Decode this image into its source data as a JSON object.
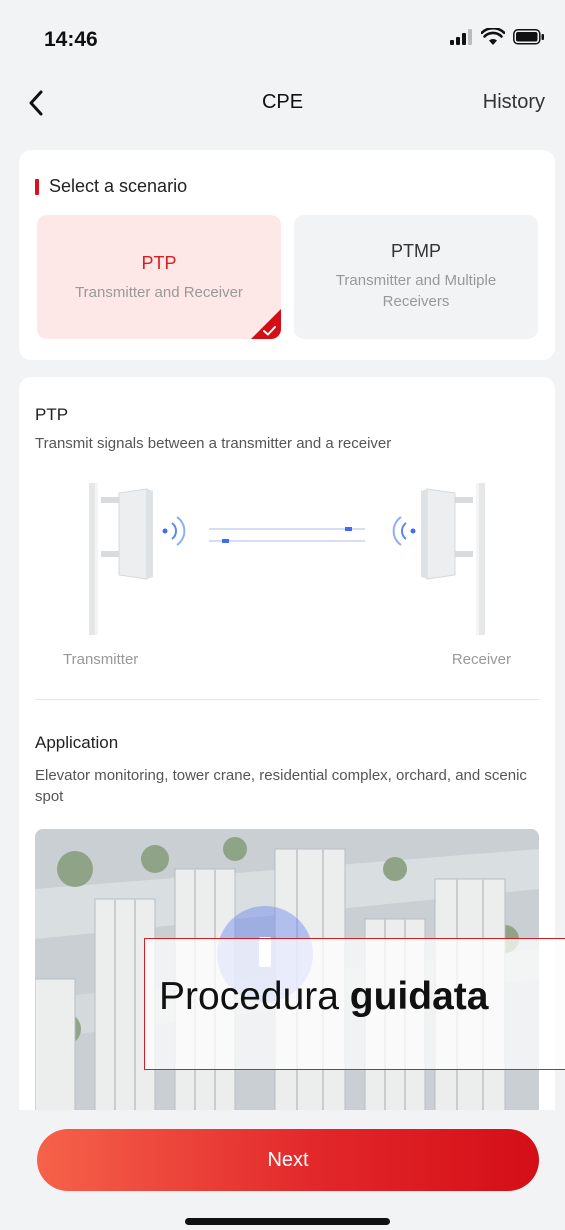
{
  "status_bar": {
    "time": "14:46"
  },
  "nav": {
    "title": "CPE",
    "history_label": "History"
  },
  "scenario": {
    "heading": "Select a scenario",
    "options": [
      {
        "name": "PTP",
        "description": "Transmitter and Receiver",
        "selected": true
      },
      {
        "name": "PTMP",
        "description": "Transmitter and Multiple Receivers",
        "selected": false
      }
    ]
  },
  "detail": {
    "title": "PTP",
    "description": "Transmit signals between a transmitter and a receiver",
    "transmitter_label": "Transmitter",
    "receiver_label": "Receiver",
    "application_title": "Application",
    "application_text": "Elevator monitoring, tower crane, residential complex, orchard, and scenic spot"
  },
  "overlay": {
    "text_regular": "Procedura ",
    "text_bold": "guidata"
  },
  "footer": {
    "next_label": "Next"
  },
  "colors": {
    "accent": "#d81e1e",
    "selected_bg": "#fde8e7",
    "button_start": "#f6624a",
    "button_end": "#d40e16"
  }
}
